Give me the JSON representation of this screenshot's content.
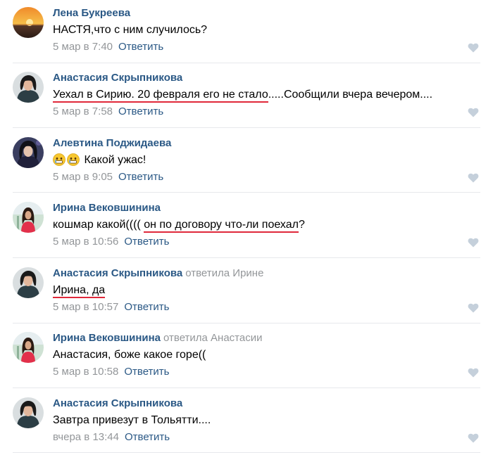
{
  "comments": [
    {
      "author": "Лена Букреева",
      "reply_to": "",
      "text_pre": "НАСТЯ,что с ним случилось?",
      "text_ul": "",
      "text_post": "",
      "date": "5 мар в 7:40",
      "reply": "Ответить"
    },
    {
      "author": "Анастасия Скрыпникова",
      "reply_to": "",
      "text_pre": "",
      "text_ul": "Уехал в Сирию. 20 февраля его не стало",
      "text_post": ".....Сообщили вчера вечером....",
      "date": "5 мар в 7:58",
      "reply": "Ответить"
    },
    {
      "author": "Алевтина Поджидаева",
      "reply_to": "",
      "text_pre": "Какой ужас!",
      "text_ul": "",
      "text_post": "",
      "emoji": [
        "sad-face-emoji",
        "sad-face-emoji"
      ],
      "date": "5 мар в 9:05",
      "reply": "Ответить"
    },
    {
      "author": "Ирина Вековшинина",
      "reply_to": "",
      "text_pre": "кошмар какой(((( ",
      "text_ul": "он по договору что-ли поехал",
      "text_post": "?",
      "date": "5 мар в 10:56",
      "reply": "Ответить"
    },
    {
      "author": "Анастасия Скрыпникова",
      "reply_to": "ответила Ирине",
      "text_pre": "",
      "text_ul": "Ирина, да",
      "text_post": "",
      "date": "5 мар в 10:57",
      "reply": "Ответить"
    },
    {
      "author": "Ирина Вековшинина",
      "reply_to": "ответила Анастасии",
      "text_pre": "Анастасия, боже какое горе((",
      "text_ul": "",
      "text_post": "",
      "date": "5 мар в 10:58",
      "reply": "Ответить"
    },
    {
      "author": "Анастасия Скрыпникова",
      "reply_to": "",
      "text_pre": "Завтра привезут в Тольятти....",
      "text_ul": "",
      "text_post": "",
      "date": "вчера в 13:44",
      "reply": "Ответить"
    }
  ],
  "colors": {
    "link": "#2a5885",
    "meta": "#939699",
    "like_icon": "#c5d0db",
    "underline": "#e0283a",
    "divider": "#e7e8ec"
  },
  "icons": {
    "like": "heart-icon"
  }
}
